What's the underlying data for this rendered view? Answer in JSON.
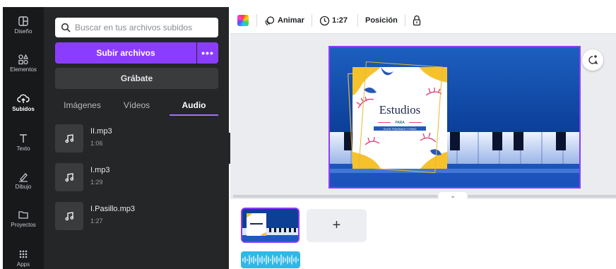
{
  "rail": [
    {
      "label": "Diseño",
      "icon": "layout-icon"
    },
    {
      "label": "Elementos",
      "icon": "shapes-icon"
    },
    {
      "label": "Subidos",
      "icon": "cloud-upload-icon",
      "active": true
    },
    {
      "label": "Texto",
      "icon": "text-icon"
    },
    {
      "label": "Dibujo",
      "icon": "pen-icon"
    },
    {
      "label": "Proyectos",
      "icon": "folder-icon"
    },
    {
      "label": "Apps",
      "icon": "apps-grid-icon"
    }
  ],
  "search": {
    "placeholder": "Buscar en tus archivos subidos"
  },
  "buttons": {
    "upload": "Subir archivos",
    "upload_more": "•••",
    "record": "Grábate"
  },
  "tabs": [
    "Imágenes",
    "Vídeos",
    "Audio"
  ],
  "active_tab": "Audio",
  "files": [
    {
      "name": "II.mp3",
      "duration": "1:06"
    },
    {
      "name": "I.mp3",
      "duration": "1:29"
    },
    {
      "name": "I.Pasillo.mp3",
      "duration": "1:27"
    }
  ],
  "toolbar": {
    "animate": "Animar",
    "duration": "1:27",
    "position": "Posición"
  },
  "design": {
    "title": "Estudios",
    "subtitle": "PARA",
    "banner": "GUITA TRANSMAS Y PIANO"
  },
  "timeline": {
    "add": "+"
  },
  "colors": {
    "accent": "#8b3dff",
    "panel": "#252627",
    "rail": "#18191b",
    "audio": "#2fb8e8"
  }
}
